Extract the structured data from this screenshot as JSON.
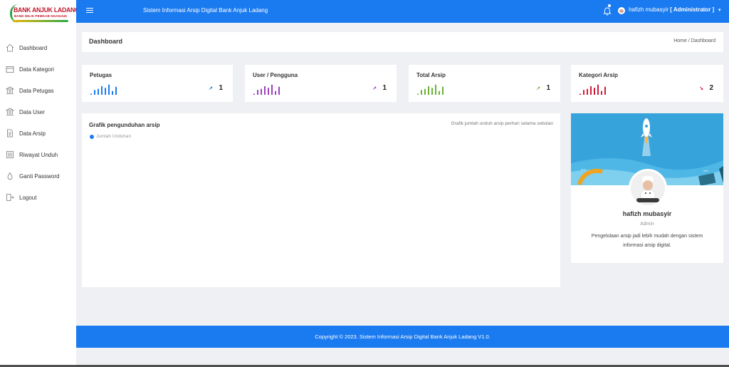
{
  "brand": {
    "logo_title": "BANK ANJUK LADANG",
    "logo_subtitle": "BANK MILIK PEMKAB NGANJUK"
  },
  "topbar": {
    "app_title": "Sistem Informasi Arsip Digital Bank Anjuk Ladang",
    "user_name": "hafizh mubasyir",
    "user_role": "[ Administrator ]"
  },
  "sidebar": {
    "items": [
      {
        "label": "Dashboard",
        "icon": "home-icon"
      },
      {
        "label": "Data Kategori",
        "icon": "folder-icon"
      },
      {
        "label": "Data Petugas",
        "icon": "bank-icon"
      },
      {
        "label": "Data User",
        "icon": "bank-icon"
      },
      {
        "label": "Data Arsip",
        "icon": "document-icon"
      },
      {
        "label": "Riwayat Unduh",
        "icon": "archive-icon"
      },
      {
        "label": "Ganti Password",
        "icon": "drop-icon"
      },
      {
        "label": "Logout",
        "icon": "logout-icon"
      }
    ]
  },
  "page": {
    "title": "Dashboard",
    "breadcrumb": "Home / Dashboard"
  },
  "stats": [
    {
      "title": "Petugas",
      "value": "1",
      "arrow": "↗",
      "color": "#1a7af0",
      "bars": [
        0.1,
        0.45,
        0.55,
        0.8,
        0.65,
        0.95,
        0.35,
        0.75
      ]
    },
    {
      "title": "User / Pengguna",
      "value": "1",
      "arrow": "↗",
      "color": "#9c3fbf",
      "bars": [
        0.1,
        0.45,
        0.55,
        0.8,
        0.65,
        0.95,
        0.35,
        0.75
      ]
    },
    {
      "title": "Total Arsip",
      "value": "1",
      "arrow": "↗",
      "color": "#6ab233",
      "bars": [
        0.1,
        0.45,
        0.55,
        0.8,
        0.65,
        0.95,
        0.35,
        0.75
      ]
    },
    {
      "title": "Kategori Arsip",
      "value": "2",
      "arrow": "↘",
      "color": "#d11a3a",
      "bars": [
        0.1,
        0.45,
        0.55,
        0.8,
        0.65,
        0.95,
        0.35,
        0.75
      ]
    }
  ],
  "chart": {
    "title": "Grafik pengunduhan arsip",
    "subtitle": "Grafik jumlah unduh arsip perhari selama sebulan",
    "legend": "Jumlah Unduhan"
  },
  "chart_data": {
    "type": "line",
    "title": "Grafik pengunduhan arsip",
    "series": [
      {
        "name": "Jumlah Unduhan",
        "values": []
      }
    ]
  },
  "profile": {
    "name": "hafizh mubasyir",
    "role": "Admin",
    "description": "Pengelolaan arsip jadi lebih mudah dengan sistem informasi arsip digital."
  },
  "footer": {
    "text": "Copyright © 2023. Sistem Informasi Arsip Digital Bank Anjuk Ladang V1.0."
  },
  "colors": {
    "primary": "#1a7af0",
    "background": "#eef0f4"
  }
}
